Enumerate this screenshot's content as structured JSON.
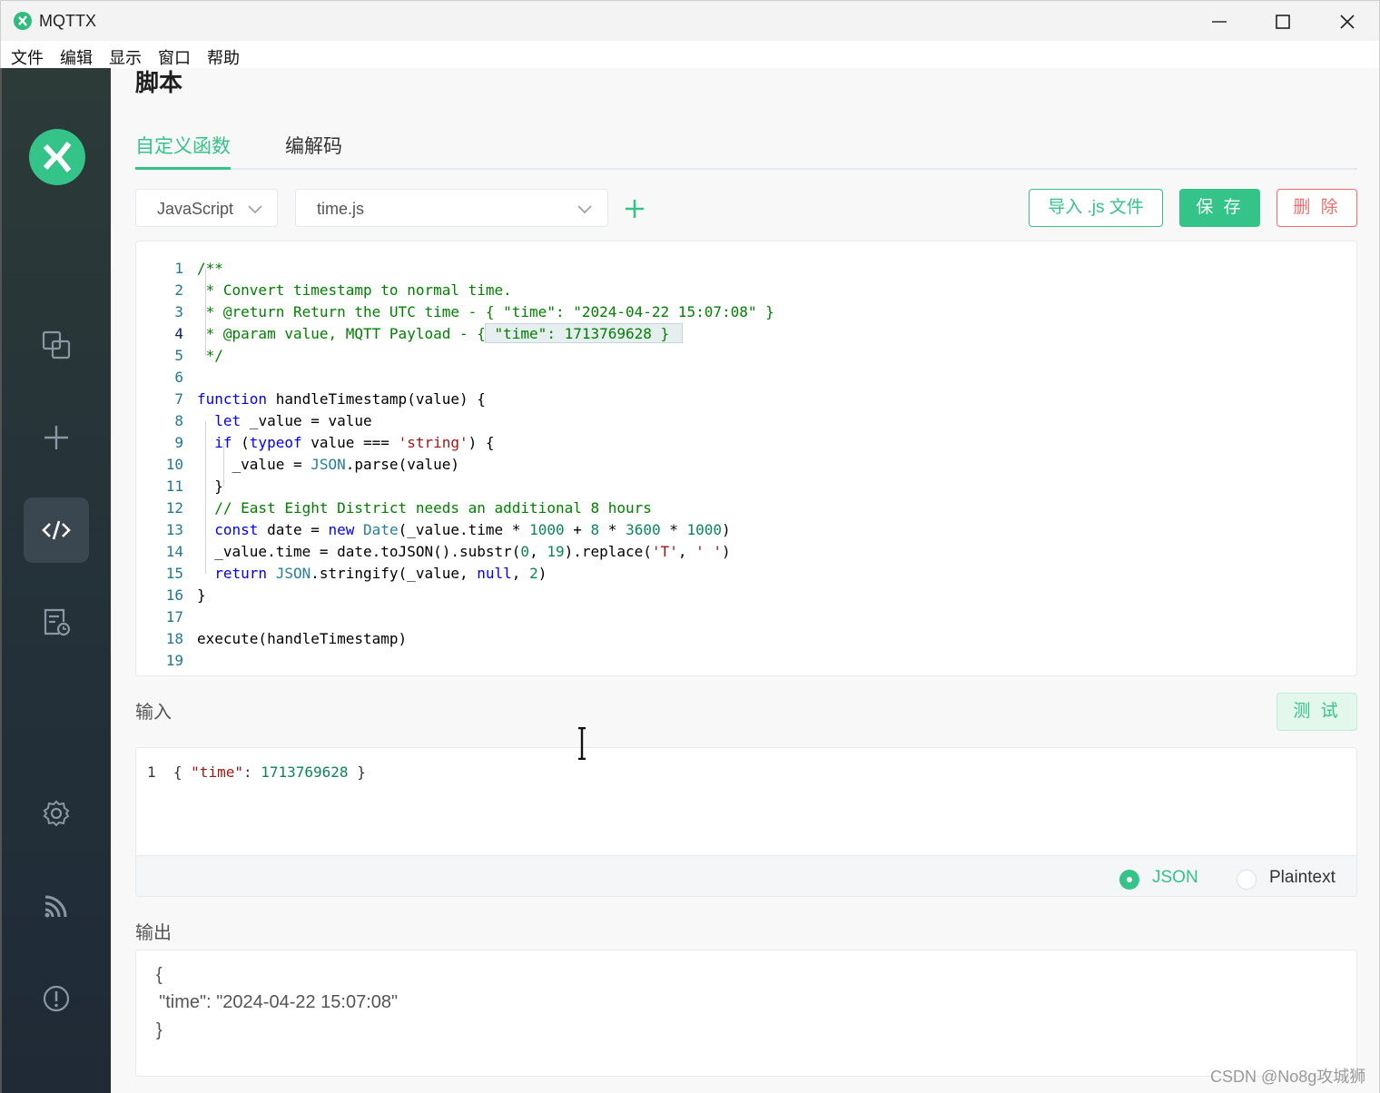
{
  "window": {
    "title": "MQTTX"
  },
  "menu": [
    "文件",
    "编辑",
    "显示",
    "窗口",
    "帮助"
  ],
  "page": {
    "title": "脚本"
  },
  "tabs": [
    {
      "label": "自定义函数",
      "active": true
    },
    {
      "label": "编解码",
      "active": false
    }
  ],
  "toolbar": {
    "language": "JavaScript",
    "script_file": "time.js",
    "import_label": "导入 .js 文件",
    "save_label": "保 存",
    "delete_label": "删 除"
  },
  "editor": {
    "current_line": 4,
    "lines": [
      {
        "n": "1",
        "tokens": [
          [
            "cm",
            "/**"
          ]
        ]
      },
      {
        "n": "2",
        "tokens": [
          [
            "cm",
            " * Convert timestamp to normal time."
          ]
        ]
      },
      {
        "n": "3",
        "tokens": [
          [
            "cm",
            " * @return Return the UTC time - { \"time\": \"2024-04-22 15:07:08\" }"
          ]
        ]
      },
      {
        "n": "4",
        "tokens": [
          [
            "cm",
            " * @param value, MQTT Payload - { \"time\": 1713769628 }"
          ]
        ]
      },
      {
        "n": "5",
        "tokens": [
          [
            "cm",
            " */"
          ]
        ]
      },
      {
        "n": "6",
        "tokens": []
      },
      {
        "n": "7",
        "tokens": [
          [
            "kw",
            "function"
          ],
          [
            "",
            " handleTimestamp(value) {"
          ]
        ]
      },
      {
        "n": "8",
        "tokens": [
          [
            "",
            "  "
          ],
          [
            "kw",
            "let"
          ],
          [
            "",
            " _value = value"
          ]
        ]
      },
      {
        "n": "9",
        "tokens": [
          [
            "",
            "  "
          ],
          [
            "kw",
            "if"
          ],
          [
            "",
            " ("
          ],
          [
            "kw",
            "typeof"
          ],
          [
            "",
            " value === "
          ],
          [
            "str",
            "'string'"
          ],
          [
            "",
            ") {"
          ]
        ]
      },
      {
        "n": "10",
        "tokens": [
          [
            "",
            "    _value = "
          ],
          [
            "ty",
            "JSON"
          ],
          [
            "",
            ".parse(value)"
          ]
        ]
      },
      {
        "n": "11",
        "tokens": [
          [
            "",
            "  }"
          ]
        ]
      },
      {
        "n": "12",
        "tokens": [
          [
            "",
            "  "
          ],
          [
            "cm",
            "// East Eight District needs an additional 8 hours"
          ]
        ]
      },
      {
        "n": "13",
        "tokens": [
          [
            "",
            "  "
          ],
          [
            "kw",
            "const"
          ],
          [
            "",
            " date = "
          ],
          [
            "kw",
            "new"
          ],
          [
            "",
            " "
          ],
          [
            "ty",
            "Date"
          ],
          [
            "",
            "(_value.time * "
          ],
          [
            "num",
            "1000"
          ],
          [
            "",
            " + "
          ],
          [
            "num",
            "8"
          ],
          [
            "",
            " * "
          ],
          [
            "num",
            "3600"
          ],
          [
            "",
            " * "
          ],
          [
            "num",
            "1000"
          ],
          [
            "",
            ")"
          ]
        ]
      },
      {
        "n": "14",
        "tokens": [
          [
            "",
            "  _value.time = date.toJSON().substr("
          ],
          [
            "num",
            "0"
          ],
          [
            "",
            ", "
          ],
          [
            "num",
            "19"
          ],
          [
            "",
            ").replace("
          ],
          [
            "str",
            "'T'"
          ],
          [
            "",
            ", "
          ],
          [
            "str",
            "' '"
          ],
          [
            "",
            ")"
          ]
        ]
      },
      {
        "n": "15",
        "tokens": [
          [
            "",
            "  "
          ],
          [
            "kw",
            "return"
          ],
          [
            "",
            " "
          ],
          [
            "ty",
            "JSON"
          ],
          [
            "",
            ".stringify(_value, "
          ],
          [
            "kw",
            "null"
          ],
          [
            "",
            ", "
          ],
          [
            "num",
            "2"
          ],
          [
            "",
            ")"
          ]
        ]
      },
      {
        "n": "16",
        "tokens": [
          [
            "",
            "}"
          ]
        ]
      },
      {
        "n": "17",
        "tokens": []
      },
      {
        "n": "18",
        "tokens": [
          [
            "",
            "execute(handleTimestamp)"
          ]
        ]
      },
      {
        "n": "19",
        "tokens": []
      }
    ]
  },
  "input": {
    "label": "输入",
    "test_label": "测 试",
    "line_number": "1",
    "tokens": [
      [
        "",
        "{ "
      ],
      [
        "str",
        "\"time\""
      ],
      [
        "",
        ": "
      ],
      [
        "num",
        "1713769628"
      ],
      [
        "",
        " }"
      ]
    ],
    "formats": [
      {
        "label": "JSON",
        "selected": true
      },
      {
        "label": "Plaintext",
        "selected": false
      }
    ]
  },
  "output": {
    "label": "输出",
    "lines": [
      "{",
      "  \"time\": \"2024-04-22 15:07:08\"",
      "}"
    ]
  },
  "watermark": "CSDN @No8g攻城狮",
  "icons": {
    "sidebar": [
      "mqttx-logo-icon",
      "connections-icon",
      "new-connection-icon",
      "script-icon",
      "log-icon",
      "settings-icon",
      "subscribe-icon",
      "about-icon"
    ]
  },
  "colors": {
    "accent": "#34c388",
    "danger": "#f56c6c",
    "sidebar": "#233039"
  }
}
